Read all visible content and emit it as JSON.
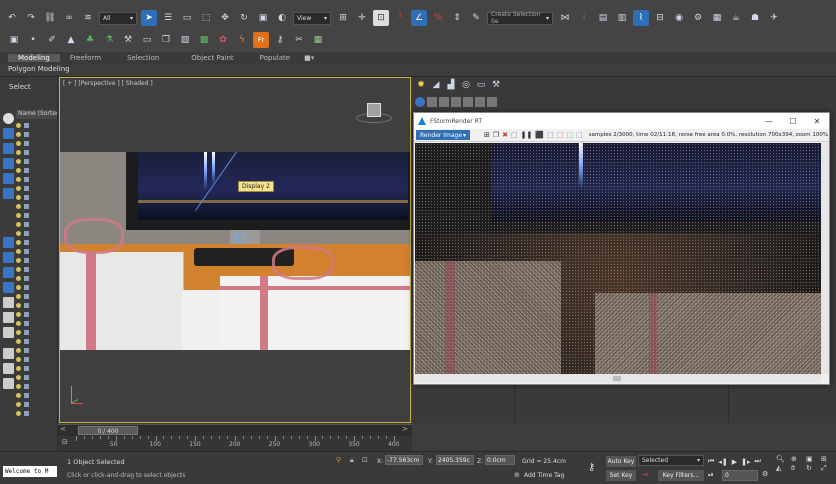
{
  "toolbar": {
    "filter_dropdown": "All",
    "view_dropdown": "View",
    "selection_set_placeholder": "Create Selection Se"
  },
  "ribbon": {
    "tabs": [
      "Modeling",
      "Freeform",
      "Selection",
      "Object Paint",
      "Populate"
    ],
    "active_tab": "Modeling",
    "panel_title": "Polygon Modeling"
  },
  "left_panel": {
    "select_label": "Select",
    "list_header": "Name (Sorted"
  },
  "viewport": {
    "label": "[ + ] [Perspective ] [ Shaded ]",
    "tooltip": "Display 2"
  },
  "render_window": {
    "title": "FStormRender RT",
    "mode_dropdown": "Render Image",
    "stats": "samples 2/3000,  time 02/11:18,  noise free area 0.0%,  resolution 700x394,  zoom 100%"
  },
  "timeline": {
    "frame_counter": "0 / 400",
    "ticks": [
      "50",
      "100",
      "150",
      "200",
      "250",
      "300",
      "350",
      "400"
    ]
  },
  "status": {
    "script_text": "Welcome to M",
    "selection": "1 Object Selected",
    "hint": "Click or click-and-drag to select objects",
    "x_label": "X:",
    "x_value": "-77.563cm",
    "y_label": "Y:",
    "y_value": "2405.359c",
    "z_label": "Z:",
    "z_value": "0.0cm",
    "grid": "Grid = 25.4cm",
    "add_time_tag": "Add Time Tag",
    "auto_key": "Auto Key",
    "selected_dropdown": "Selected",
    "set_key": "Set Key",
    "key_filters": "Key Filters...",
    "frame": "0"
  }
}
